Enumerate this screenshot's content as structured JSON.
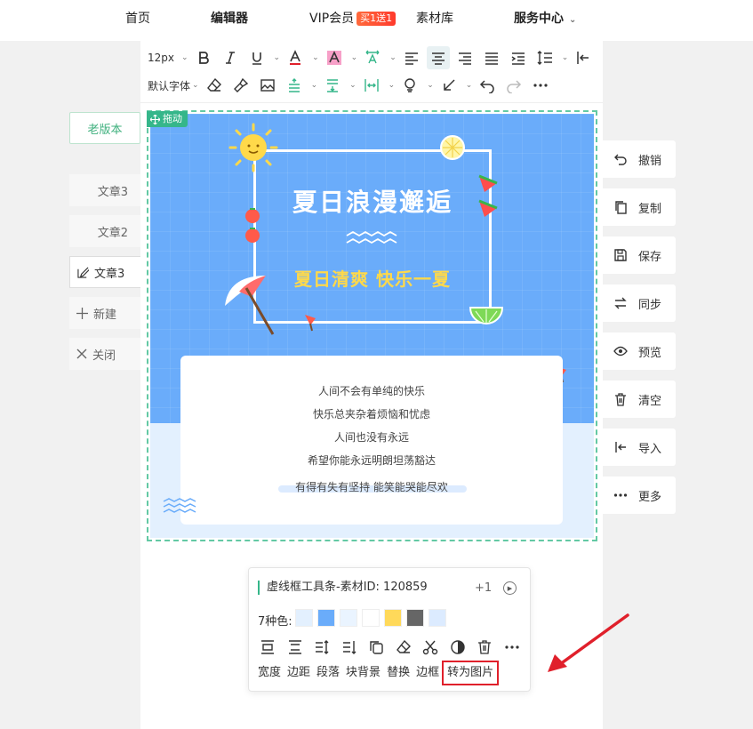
{
  "nav": {
    "home": "首页",
    "editor": "编辑器",
    "vip": "VIP会员",
    "vip_badge": "买1送1",
    "library": "素材库",
    "service": "服务中心"
  },
  "toolbar": {
    "font_size": "12px",
    "font_family": "默认字体"
  },
  "left": {
    "old_version": "老版本",
    "tabs": [
      {
        "label": "文章3"
      },
      {
        "label": "文章2"
      },
      {
        "label": "文章3"
      },
      {
        "label": "新建"
      },
      {
        "label": "关闭"
      }
    ]
  },
  "canvas": {
    "drag_label": "拖动",
    "title": "夏日浪漫邂逅",
    "subtitle": "夏日清爽 快乐一夏",
    "lines": [
      "人间不会有单纯的快乐",
      "快乐总夹杂着烦恼和忧虑",
      "人间也没有永远",
      "希望你能永远明朗坦荡豁达",
      "有得有失有坚持 能笑能哭能尽欢"
    ]
  },
  "right": {
    "buttons": [
      {
        "label": "撤销",
        "icon": "undo-icon"
      },
      {
        "label": "复制",
        "icon": "copy-icon"
      },
      {
        "label": "保存",
        "icon": "save-icon"
      },
      {
        "label": "同步",
        "icon": "sync-icon"
      },
      {
        "label": "预览",
        "icon": "eye-icon"
      },
      {
        "label": "清空",
        "icon": "trash-icon"
      },
      {
        "label": "导入",
        "icon": "import-icon"
      },
      {
        "label": "更多",
        "icon": "more-icon"
      }
    ]
  },
  "float_toolbar": {
    "title": "虚线框工具条-素材ID: 120859",
    "plus": "+1",
    "colors_label": "7种色:",
    "colors": [
      "#e3f0fe",
      "#6aacfa",
      "#eaf4ff",
      "#ffffff",
      "#ffd95a",
      "#666666",
      "#dcebff"
    ],
    "labels": [
      "宽度",
      "边距",
      "段落",
      "块背景",
      "替换",
      "边框",
      "转为图片"
    ]
  },
  "colors": {
    "accent": "#35b68a",
    "poster_blue": "#6aacfa",
    "highlight_red": "#e0202b"
  }
}
